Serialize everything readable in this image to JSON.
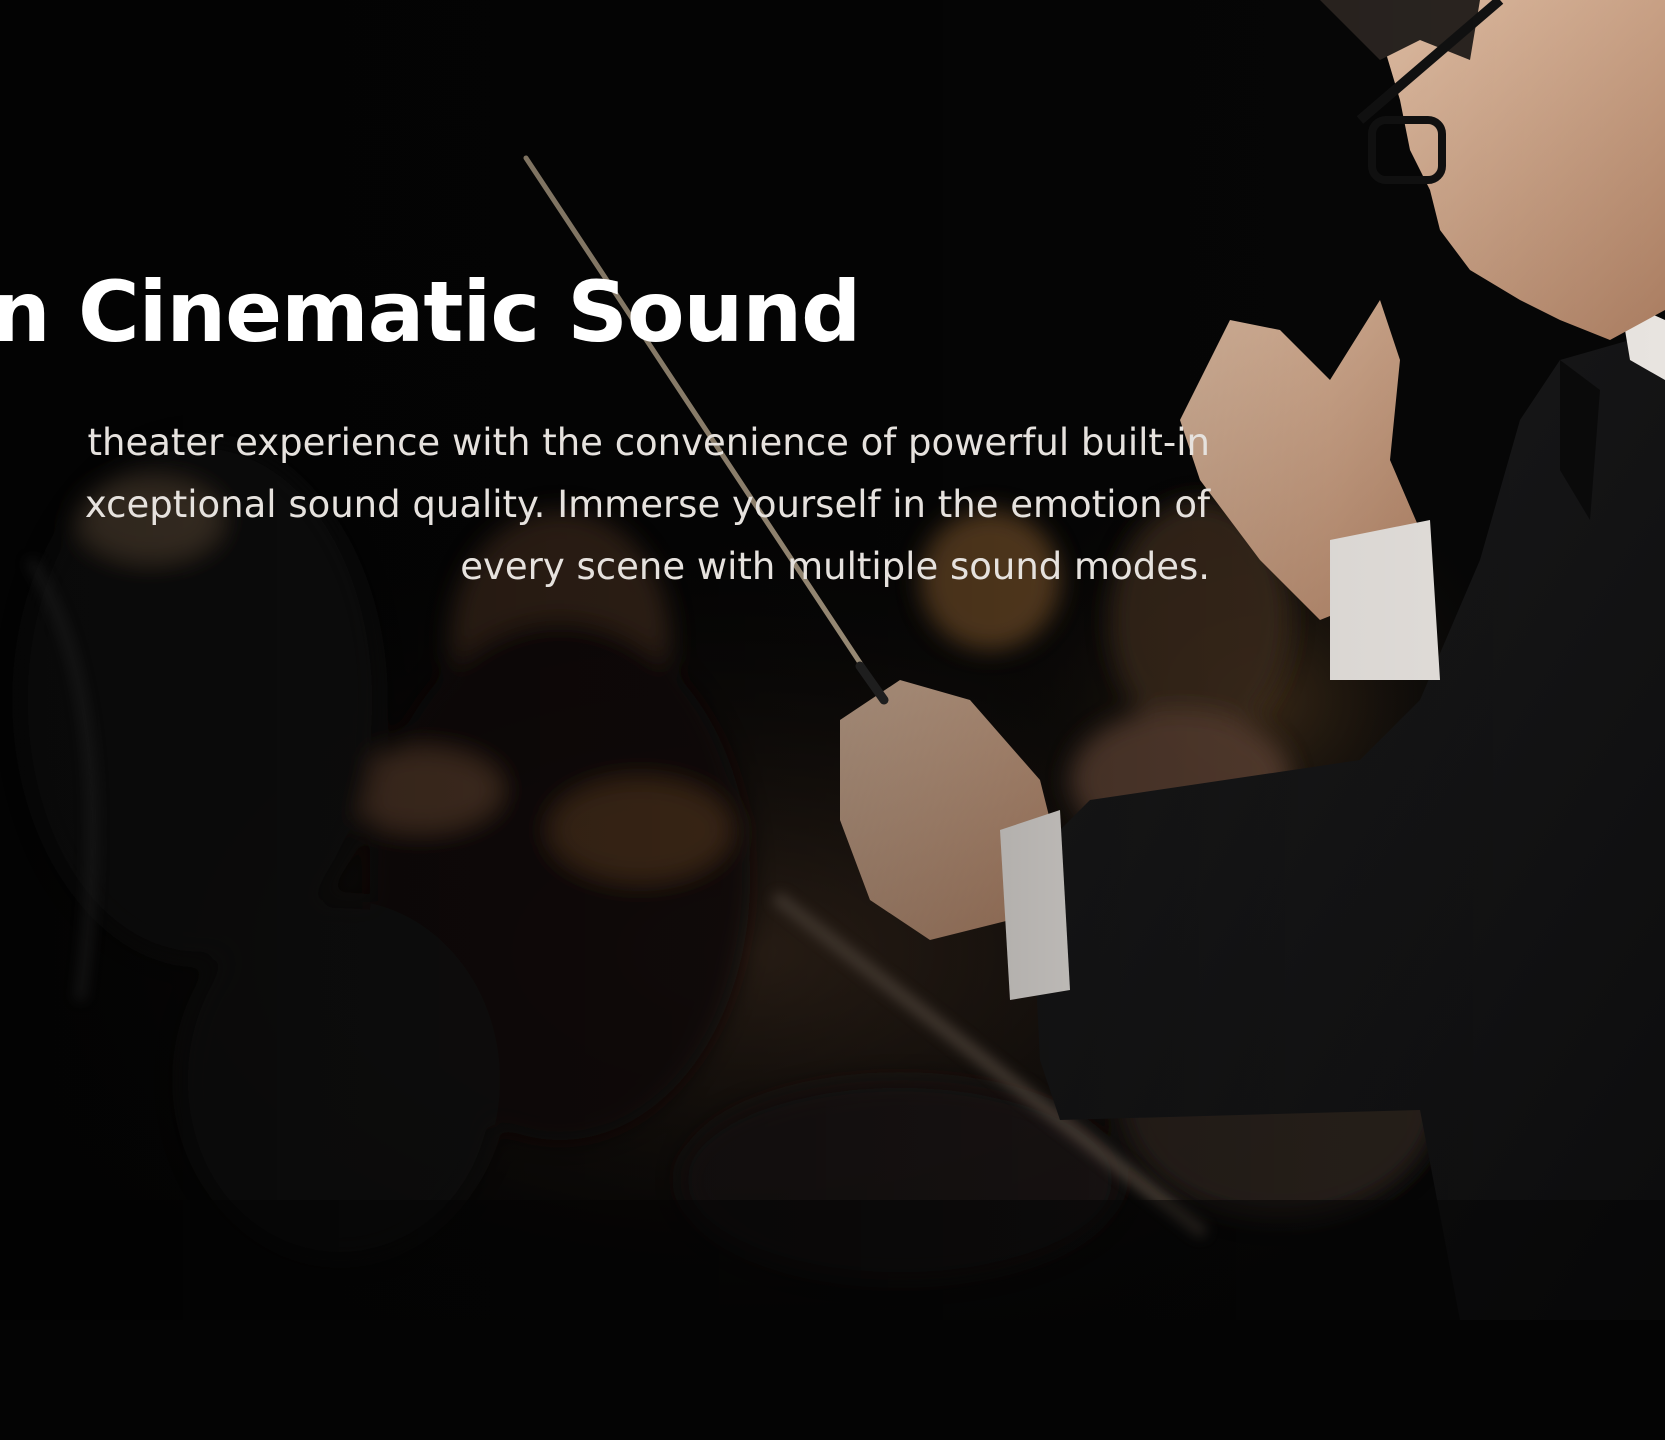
{
  "hero": {
    "headline": "k in Cinematic Sound",
    "description_lines": [
      "theater experience with the convenience of powerful built-in",
      "xceptional sound quality. Immerse yourself in the emotion of",
      "every scene with multiple sound modes."
    ],
    "image_description": "conductor-leading-orchestra-photo"
  },
  "colors": {
    "background": "#040404",
    "headline": "#ffffff",
    "body_text": "#e6e2de"
  }
}
